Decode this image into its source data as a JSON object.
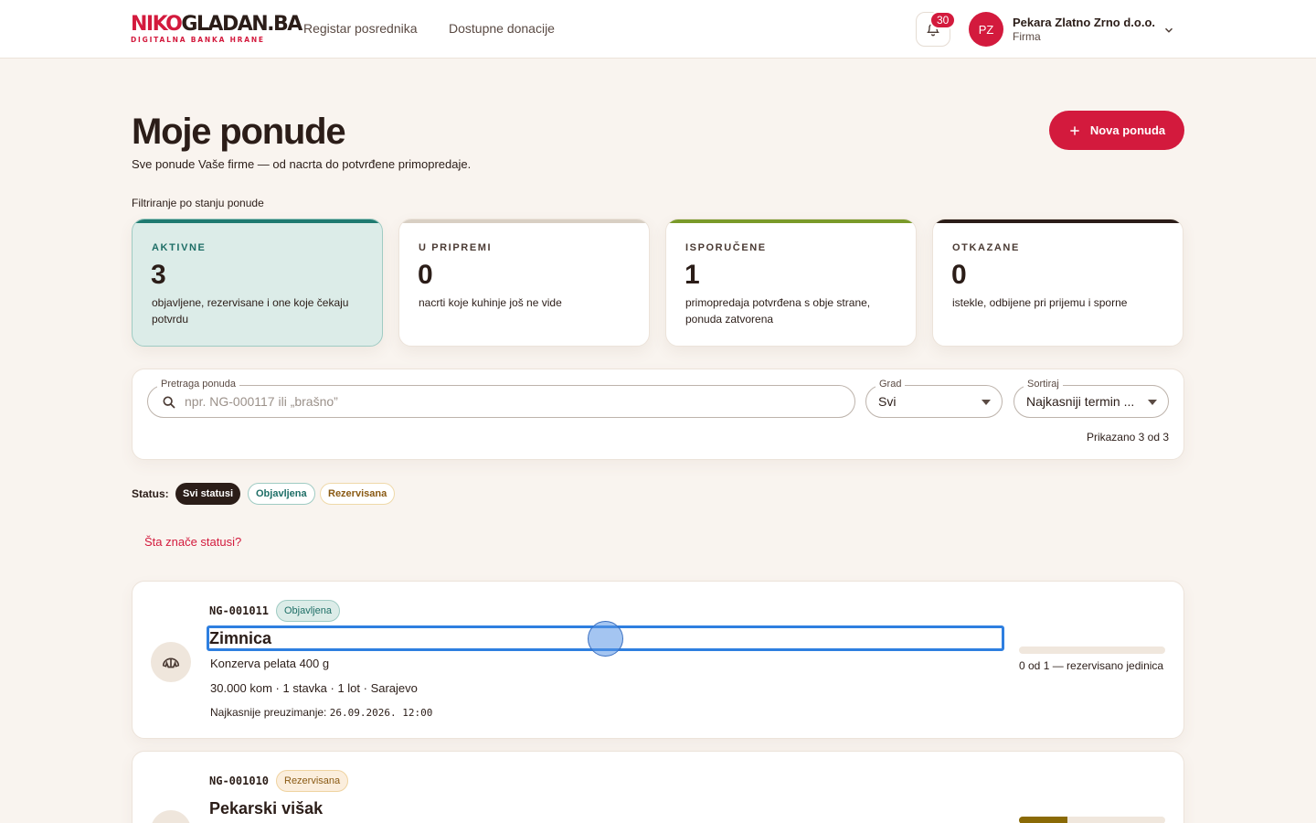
{
  "header": {
    "logo_main_a": "NIKO",
    "logo_main_b": "GLADAN.BA",
    "logo_sub": "DIGITALNA BANKA HRANE",
    "nav": [
      "Registar posrednika",
      "Dostupne donacije"
    ],
    "notifications": "30",
    "avatar_initials": "PZ",
    "company_name": "Pekara Zlatno Zrno d.o.o.",
    "company_role": "Firma"
  },
  "page": {
    "title": "Moje ponude",
    "subtitle": "Sve ponude Vaše firme — od nacrta do potvrđene primopredaje.",
    "new_button": "Nova ponuda",
    "filter_label": "Filtriranje po stanju ponude"
  },
  "stats": [
    {
      "label": "AKTIVNE",
      "value": "3",
      "desc": "objavljene, rezervisane i one koje čekaju potvrdu",
      "color": "#1e7a70"
    },
    {
      "label": "U PRIPREMI",
      "value": "0",
      "desc": "nacrti koje kuhinje još ne vide",
      "color": "#d8cfc3"
    },
    {
      "label": "ISPORUČENE",
      "value": "1",
      "desc": "primopredaja potvrđena s obje strane, ponuda zatvorena",
      "color": "#7a9a2a"
    },
    {
      "label": "OTKAZANE",
      "value": "0",
      "desc": "istekle, odbijene pri prijemu i sporne",
      "color": "#2b1d18"
    }
  ],
  "search": {
    "legend": "Pretraga ponuda",
    "placeholder": "npr. NG-000117 ili „brašno”",
    "city_legend": "Grad",
    "city_value": "Svi",
    "sort_legend": "Sortiraj",
    "sort_value": "Najkasniji termin ...",
    "count": "Prikazano 3 od 3"
  },
  "status_filter": {
    "label": "Status:",
    "chips": [
      "Svi statusi",
      "Objavljena",
      "Rezervisana"
    ],
    "help": "Šta znače statusi?"
  },
  "offers": [
    {
      "id": "NG-001011",
      "status": "Objavljena",
      "title": "Zimnica",
      "item": "Konzerva pelata 400 g",
      "meta": "30.000 kom · 1 stavka · 1 lot · Sarajevo",
      "pickup_label": "Najkasnije preuzimanje:",
      "pickup_time": "26.09.2026. 12:00",
      "progress_text": "0 od 1 — rezervisano jedinica",
      "progress": 0
    },
    {
      "id": "NG-001010",
      "status": "Rezervisana",
      "title": "Pekarski višak",
      "progress": 0.33
    }
  ]
}
